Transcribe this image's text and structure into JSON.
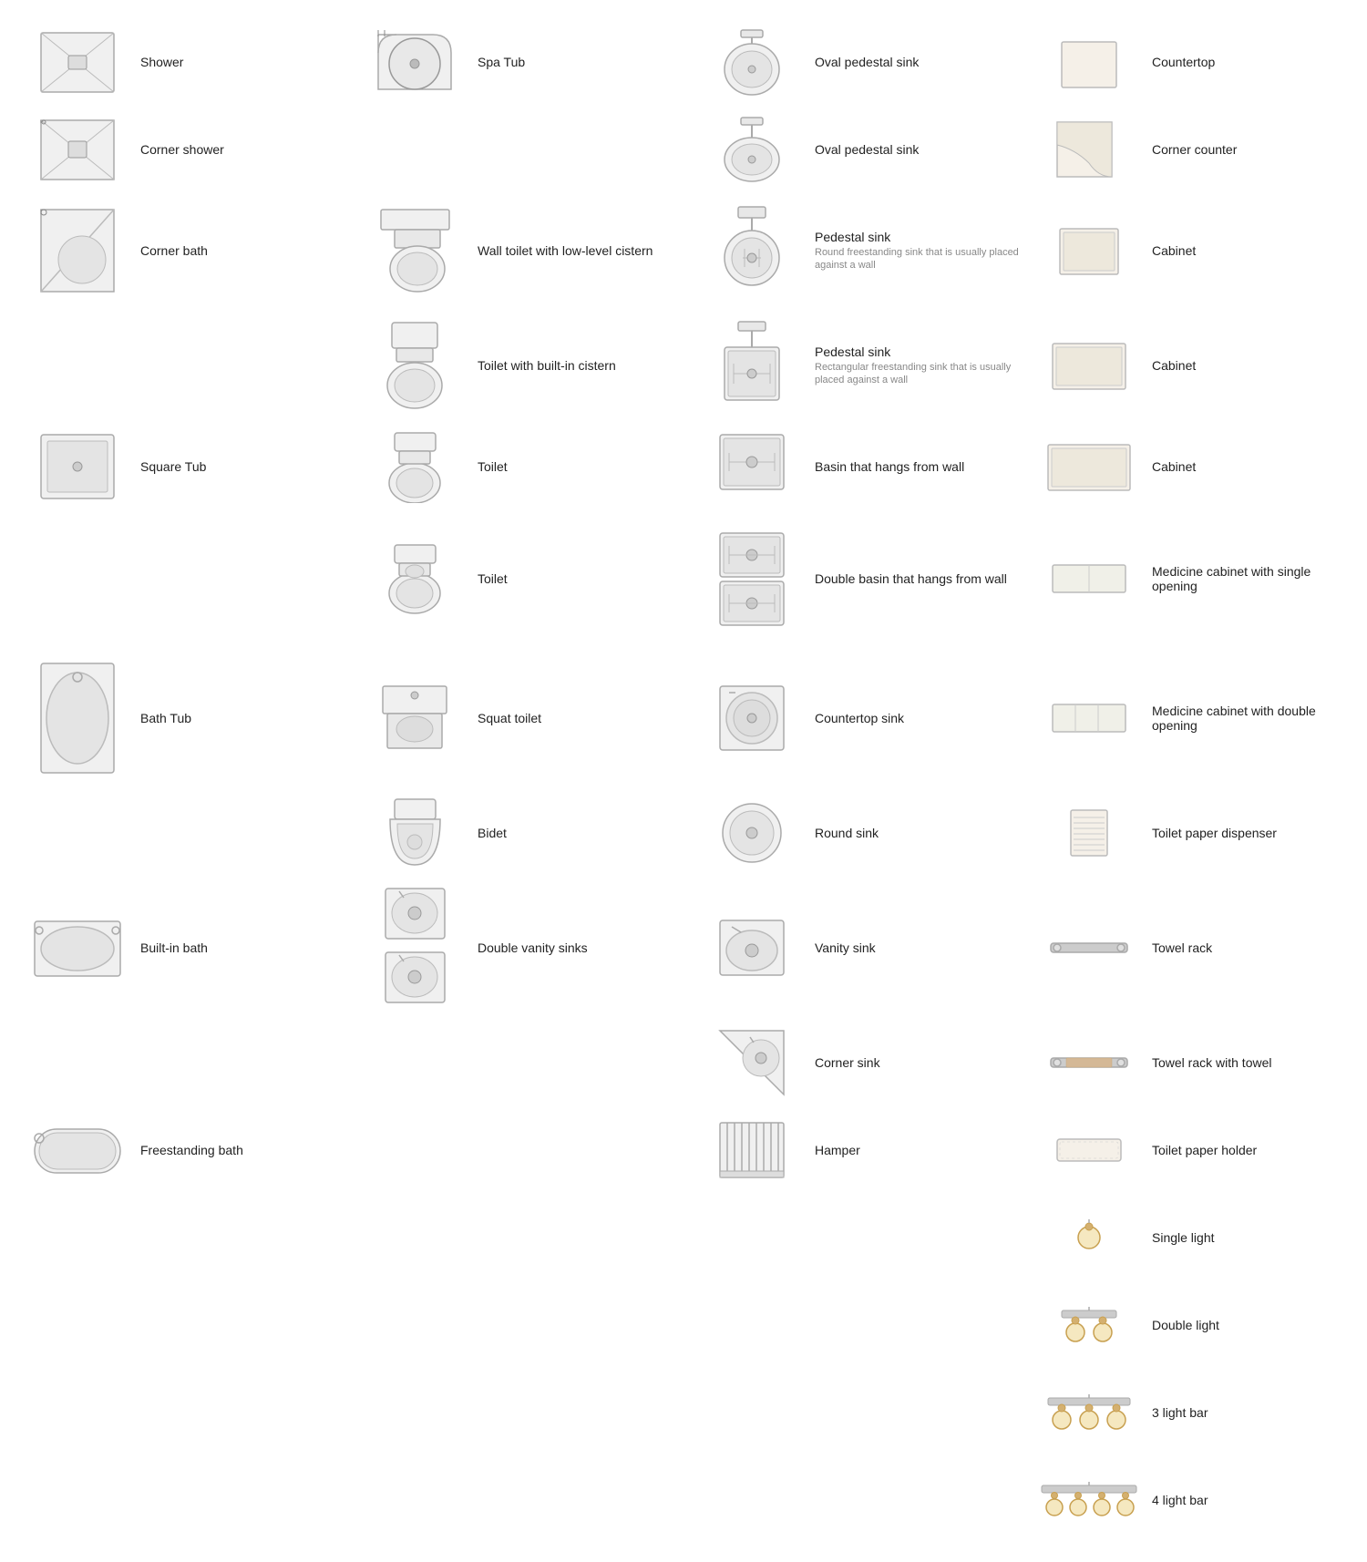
{
  "items": [
    {
      "id": "shower",
      "label": "Shower",
      "sub": "",
      "col": 0
    },
    {
      "id": "spa-tub",
      "label": "Spa Tub",
      "sub": "",
      "col": 1
    },
    {
      "id": "oval-pedestal-sink-1",
      "label": "Oval pedestal sink",
      "sub": "",
      "col": 2
    },
    {
      "id": "countertop",
      "label": "Countertop",
      "sub": "",
      "col": 3
    },
    {
      "id": "corner-shower",
      "label": "Corner shower",
      "sub": "",
      "col": 0
    },
    {
      "id": "empty1",
      "label": "",
      "sub": "",
      "col": 1
    },
    {
      "id": "oval-pedestal-sink-2",
      "label": "Oval pedestal sink",
      "sub": "",
      "col": 2
    },
    {
      "id": "corner-counter",
      "label": "Corner counter",
      "sub": "",
      "col": 3
    },
    {
      "id": "corner-bath",
      "label": "Corner bath",
      "sub": "",
      "col": 0
    },
    {
      "id": "wall-toilet",
      "label": "Wall toilet with low-level cistern",
      "sub": "",
      "col": 1
    },
    {
      "id": "pedestal-sink-round",
      "label": "Pedestal sink",
      "sub": "Round freestanding sink that is usually placed against a wall",
      "col": 2
    },
    {
      "id": "cabinet-1",
      "label": "Cabinet",
      "sub": "",
      "col": 3
    },
    {
      "id": "empty2",
      "label": "",
      "sub": "",
      "col": 0
    },
    {
      "id": "toilet-builtin",
      "label": "Toilet with built-in cistern",
      "sub": "",
      "col": 1
    },
    {
      "id": "pedestal-sink-rect",
      "label": "Pedestal sink",
      "sub": "Rectangular freestanding sink that is usually placed against a wall",
      "col": 2
    },
    {
      "id": "cabinet-2",
      "label": "Cabinet",
      "sub": "",
      "col": 3
    },
    {
      "id": "square-tub",
      "label": "Square Tub",
      "sub": "",
      "col": 0
    },
    {
      "id": "toilet-1",
      "label": "Toilet",
      "sub": "",
      "col": 1
    },
    {
      "id": "basin-wall",
      "label": "Basin that hangs from wall",
      "sub": "",
      "col": 2
    },
    {
      "id": "cabinet-3",
      "label": "Cabinet",
      "sub": "",
      "col": 3
    },
    {
      "id": "empty3",
      "label": "",
      "sub": "",
      "col": 0
    },
    {
      "id": "toilet-2",
      "label": "Toilet",
      "sub": "",
      "col": 1
    },
    {
      "id": "double-basin",
      "label": "Double basin that hangs from wall",
      "sub": "",
      "col": 2
    },
    {
      "id": "medicine-single",
      "label": "Medicine cabinet with single opening",
      "sub": "",
      "col": 3
    },
    {
      "id": "bath-tub",
      "label": "Bath Tub",
      "sub": "",
      "col": 0
    },
    {
      "id": "squat-toilet",
      "label": "Squat toilet",
      "sub": "",
      "col": 1
    },
    {
      "id": "countertop-sink",
      "label": "Countertop sink",
      "sub": "",
      "col": 2
    },
    {
      "id": "medicine-double",
      "label": "Medicine cabinet with double opening",
      "sub": "",
      "col": 3
    },
    {
      "id": "empty4",
      "label": "",
      "sub": "",
      "col": 0
    },
    {
      "id": "bidet",
      "label": "Bidet",
      "sub": "",
      "col": 1
    },
    {
      "id": "round-sink",
      "label": "Round sink",
      "sub": "",
      "col": 2
    },
    {
      "id": "toilet-paper",
      "label": "Toilet paper dispenser",
      "sub": "",
      "col": 3
    },
    {
      "id": "built-in-bath",
      "label": "Built-in bath",
      "sub": "",
      "col": 0
    },
    {
      "id": "double-vanity",
      "label": "Double vanity sinks",
      "sub": "",
      "col": 1
    },
    {
      "id": "vanity-sink",
      "label": "Vanity sink",
      "sub": "",
      "col": 2
    },
    {
      "id": "towel-rack",
      "label": "Towel rack",
      "sub": "",
      "col": 3
    },
    {
      "id": "empty5",
      "label": "",
      "sub": "",
      "col": 0
    },
    {
      "id": "empty6",
      "label": "",
      "sub": "",
      "col": 1
    },
    {
      "id": "corner-sink",
      "label": "Corner sink",
      "sub": "",
      "col": 2
    },
    {
      "id": "towel-rack-towel",
      "label": "Towel rack with towel",
      "sub": "",
      "col": 3
    },
    {
      "id": "freestanding-bath",
      "label": "Freestanding bath",
      "sub": "",
      "col": 0
    },
    {
      "id": "empty7",
      "label": "",
      "sub": "",
      "col": 1
    },
    {
      "id": "hamper",
      "label": "Hamper",
      "sub": "",
      "col": 2
    },
    {
      "id": "toilet-paper-holder",
      "label": "Toilet paper holder",
      "sub": "",
      "col": 3
    },
    {
      "id": "empty8",
      "label": "",
      "sub": "",
      "col": 0
    },
    {
      "id": "empty9",
      "label": "",
      "sub": "",
      "col": 1
    },
    {
      "id": "empty10",
      "label": "",
      "sub": "",
      "col": 2
    },
    {
      "id": "single-light",
      "label": "Single light",
      "sub": "",
      "col": 3
    },
    {
      "id": "empty11",
      "label": "",
      "sub": "",
      "col": 0
    },
    {
      "id": "empty12",
      "label": "",
      "sub": "",
      "col": 1
    },
    {
      "id": "empty13",
      "label": "",
      "sub": "",
      "col": 2
    },
    {
      "id": "double-light",
      "label": "Double light",
      "sub": "",
      "col": 3
    },
    {
      "id": "empty14",
      "label": "",
      "sub": "",
      "col": 0
    },
    {
      "id": "empty15",
      "label": "",
      "sub": "",
      "col": 1
    },
    {
      "id": "empty16",
      "label": "",
      "sub": "",
      "col": 2
    },
    {
      "id": "3-light-bar",
      "label": "3 light bar",
      "sub": "",
      "col": 3
    },
    {
      "id": "empty17",
      "label": "",
      "sub": "",
      "col": 0
    },
    {
      "id": "empty18",
      "label": "",
      "sub": "",
      "col": 1
    },
    {
      "id": "empty19",
      "label": "",
      "sub": "",
      "col": 2
    },
    {
      "id": "4-light-bar",
      "label": "4 light bar",
      "sub": "",
      "col": 3
    }
  ]
}
